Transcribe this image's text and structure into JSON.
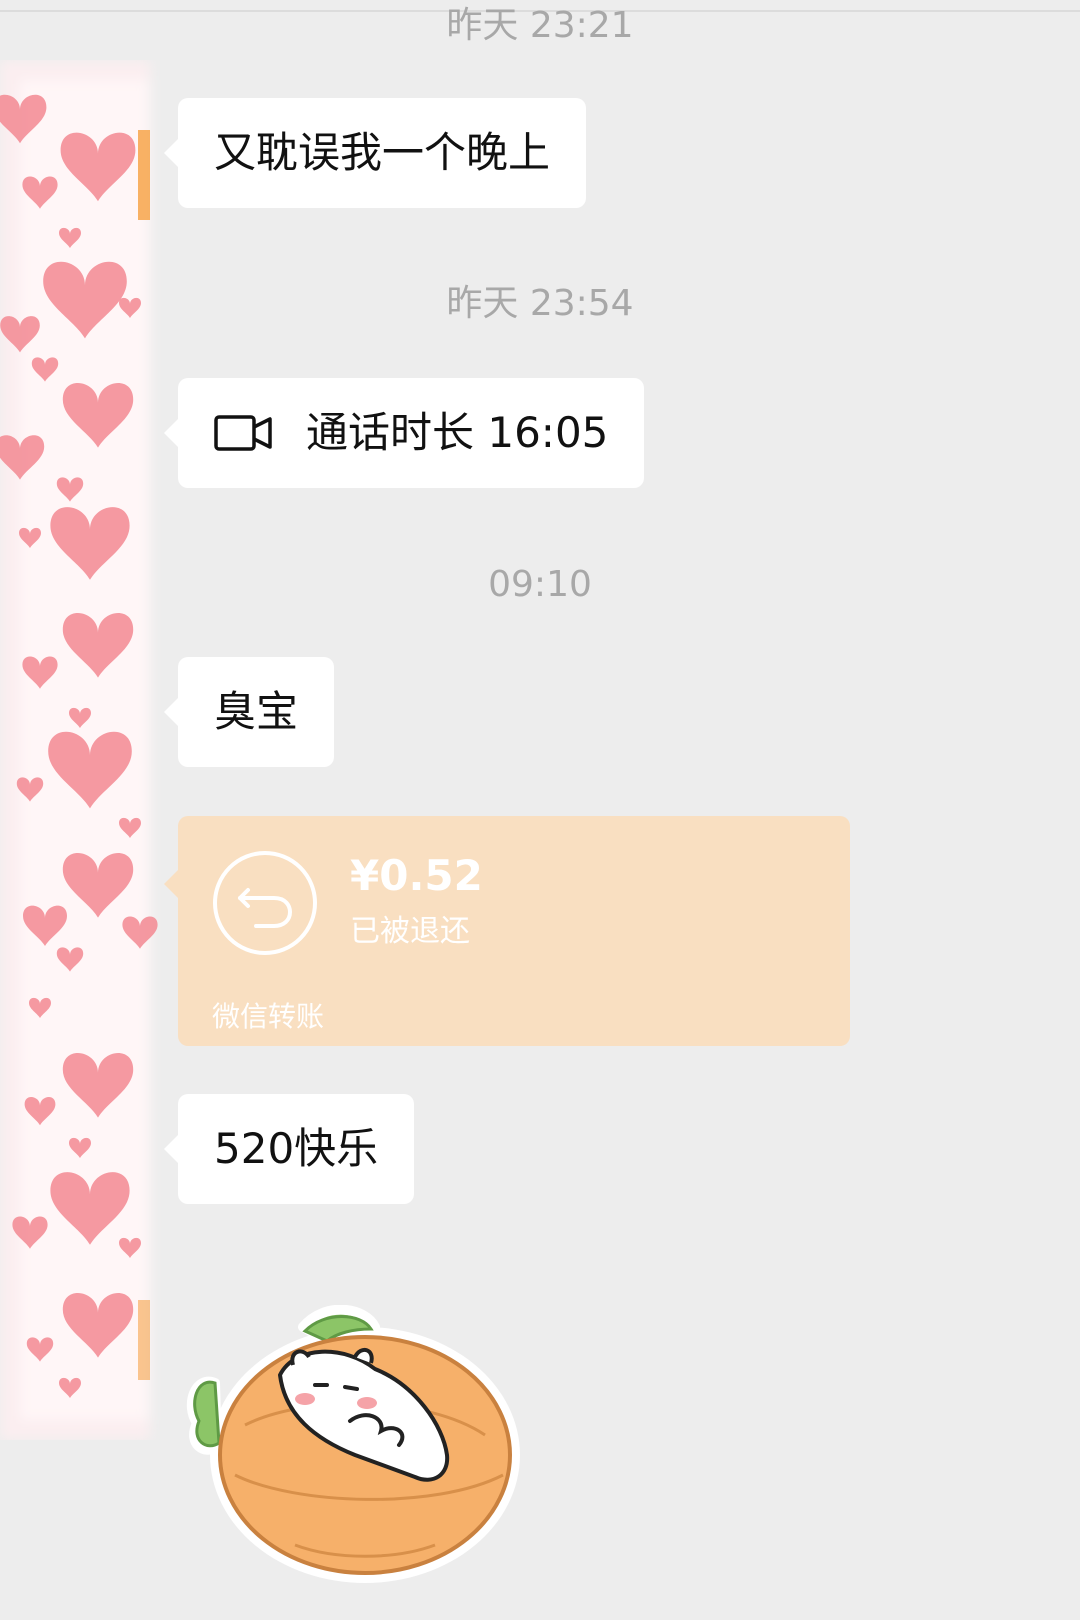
{
  "timestamps": {
    "t1": "昨天 23:21",
    "t2": "昨天 23:54",
    "t3": "09:10"
  },
  "messages": {
    "m1": "又耽误我一个晚上",
    "call": "通话时长 16:05",
    "m2": "臭宝",
    "m3": "520快乐"
  },
  "transfer": {
    "amount": "¥0.52",
    "status": "已被退还",
    "footer": "微信转账"
  },
  "colors": {
    "background": "#ededed",
    "bubble": "#ffffff",
    "transfer_bg": "#f9dfc1",
    "avatar_heart": "#f48f98"
  },
  "icons": {
    "call": "video-call-icon",
    "transfer": "return-arrow-icon",
    "avatar": "heart-pattern-avatar",
    "sticker": "hamster-on-carrot-sticker"
  }
}
